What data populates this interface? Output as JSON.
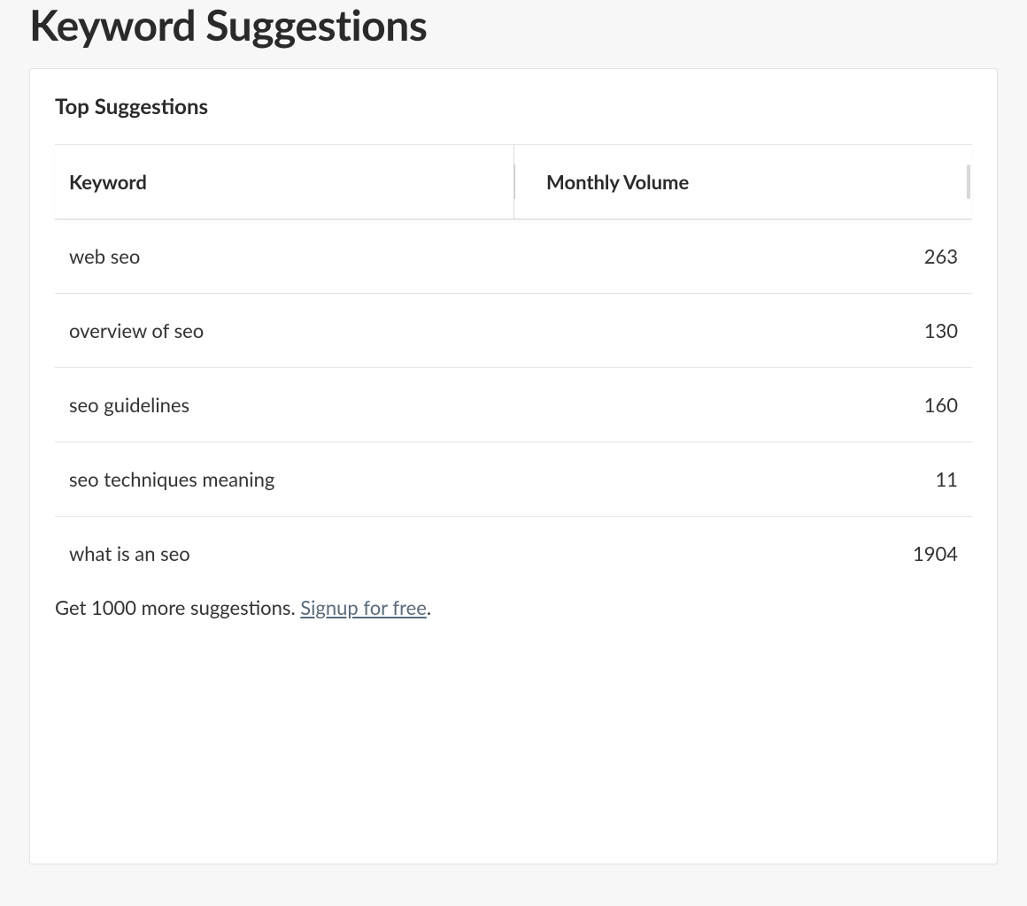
{
  "page": {
    "title": "Keyword Suggestions"
  },
  "card": {
    "title": "Top Suggestions",
    "columns": {
      "keyword": "Keyword",
      "volume": "Monthly Volume"
    },
    "rows": [
      {
        "keyword": "web seo",
        "volume": "263"
      },
      {
        "keyword": "overview of seo",
        "volume": "130"
      },
      {
        "keyword": "seo guidelines",
        "volume": "160"
      },
      {
        "keyword": "seo techniques meaning",
        "volume": "11"
      },
      {
        "keyword": "what is an seo",
        "volume": "1904"
      }
    ],
    "cta": {
      "prefix": "Get 1000 more suggestions. ",
      "link_text": "Signup for free",
      "suffix": "."
    }
  }
}
